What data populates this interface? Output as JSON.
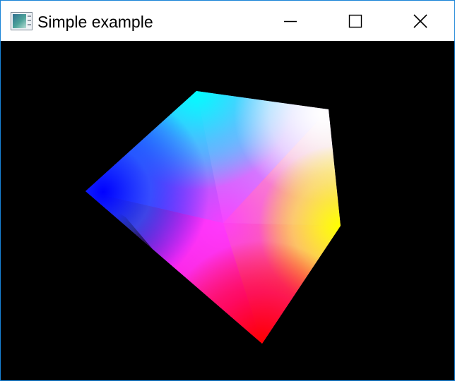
{
  "window": {
    "title": "Simple example",
    "app_icon": "window-app-icon",
    "controls": {
      "minimize_icon": "minimize-icon",
      "maximize_icon": "maximize-icon",
      "close_icon": "close-icon"
    },
    "border_color": "#1883d7"
  },
  "viewport": {
    "background_color": "#000000",
    "shape": {
      "type": "pentagon",
      "vertex_colors": [
        "#00ffff",
        "#ffffff",
        "#ffff00",
        "#ff0000",
        "#0000ff"
      ]
    }
  }
}
